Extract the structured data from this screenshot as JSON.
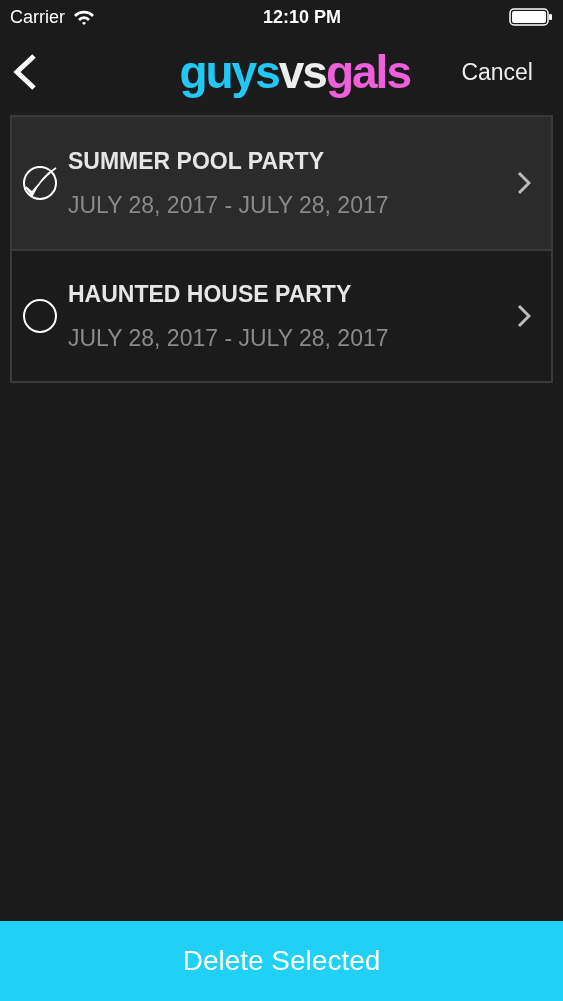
{
  "status_bar": {
    "carrier": "Carrier",
    "time": "12:10 PM"
  },
  "nav": {
    "logo": [
      {
        "text": "guys",
        "color": "#22c7f4"
      },
      {
        "text": "vs",
        "color": "#eeeeee"
      },
      {
        "text": "gals",
        "color": "#ee5fd9"
      }
    ],
    "cancel": "Cancel"
  },
  "events": [
    {
      "title": "SUMMER POOL PARTY",
      "dates": "JULY 28, 2017 - JULY 28, 2017",
      "checked": true
    },
    {
      "title": "HAUNTED HOUSE PARTY",
      "dates": "JULY 28, 2017 - JULY 28, 2017",
      "checked": false
    }
  ],
  "delete_button": "Delete Selected"
}
